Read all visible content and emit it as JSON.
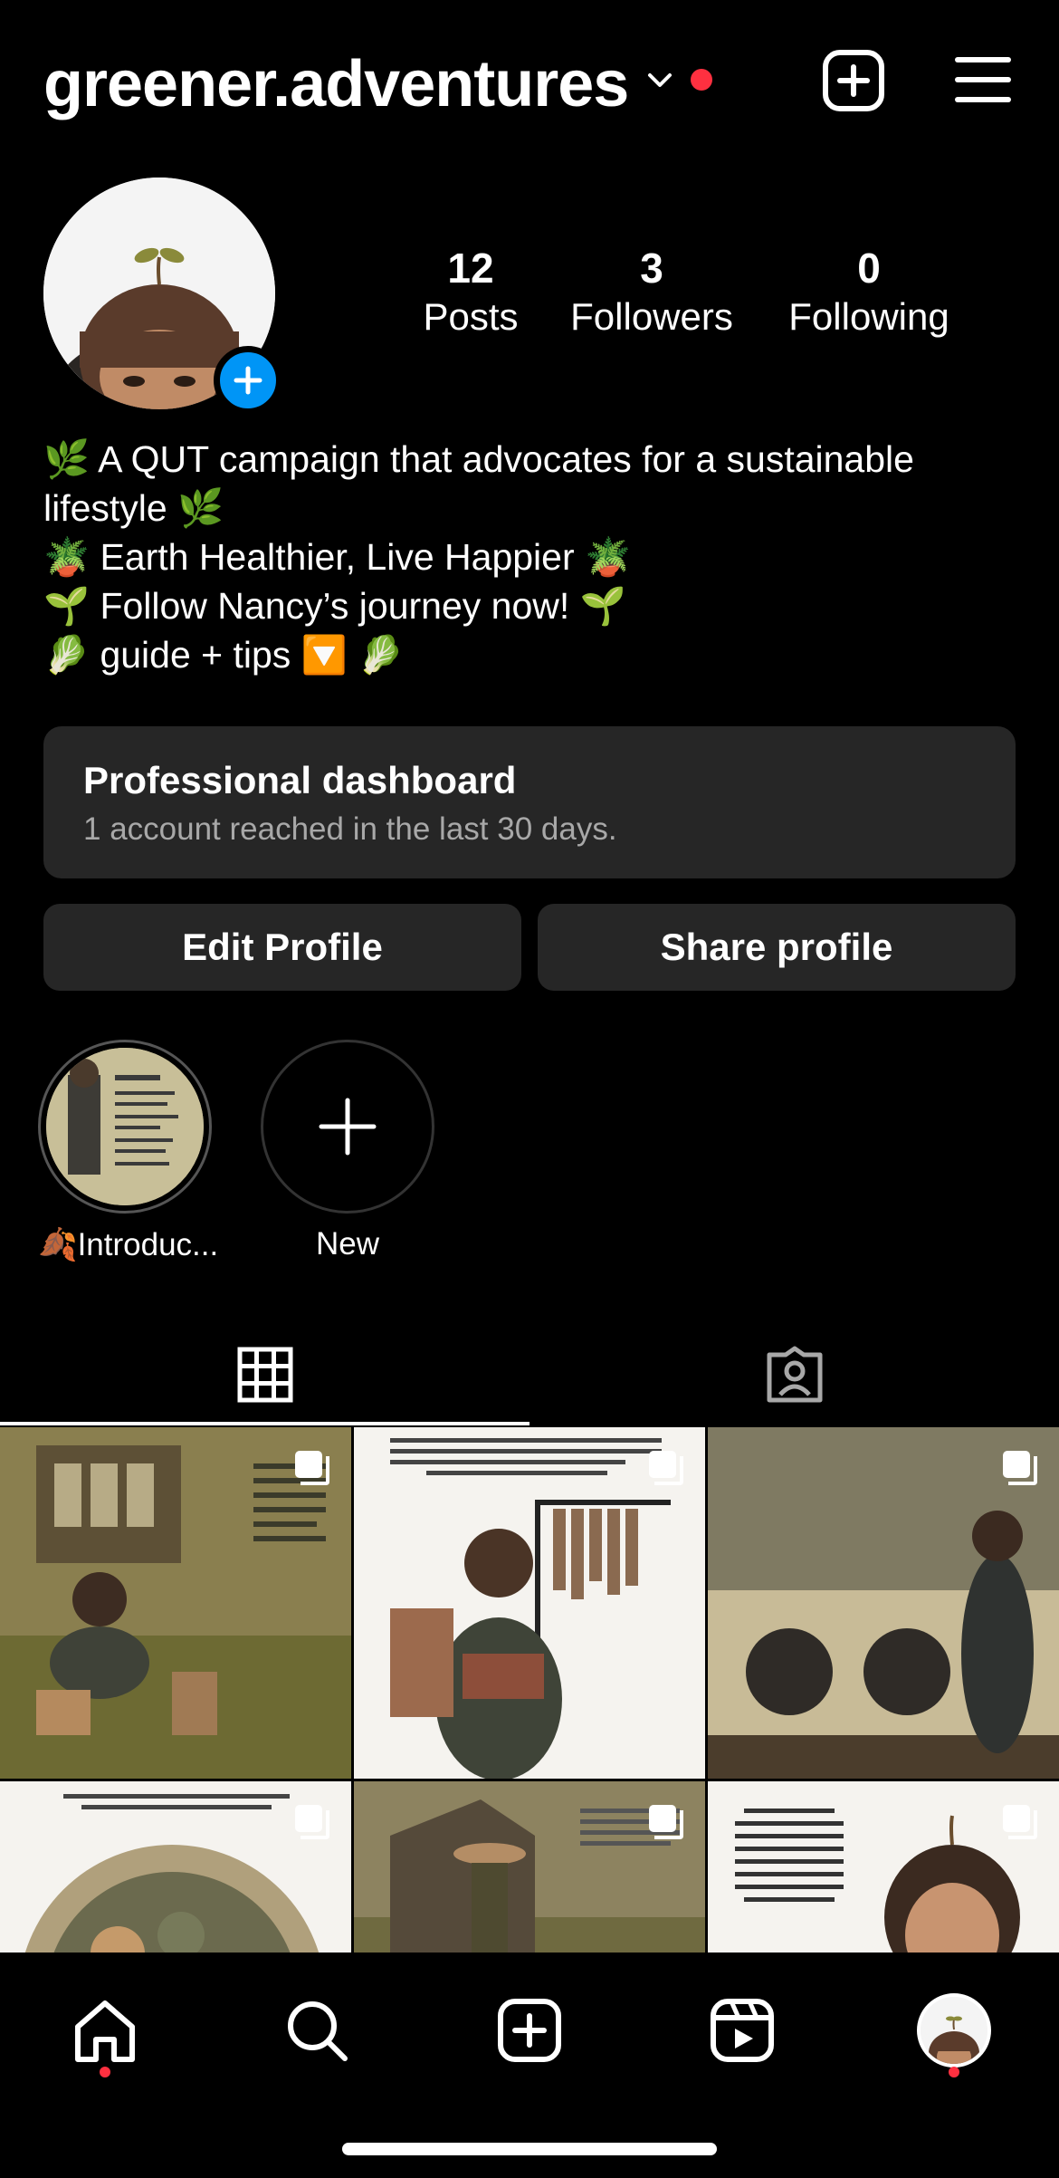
{
  "header": {
    "username": "greener.adventures",
    "notification_color": "#ff3040"
  },
  "profile": {
    "stats": [
      {
        "value": "12",
        "label": "Posts"
      },
      {
        "value": "3",
        "label": "Followers"
      },
      {
        "value": "0",
        "label": "Following"
      }
    ],
    "bio": [
      "🌿 A QUT campaign that advocates for a sustainable lifestyle 🌿",
      "🪴 Earth Healthier, Live Happier 🪴",
      "🌱 Follow Nancy’s journey now! 🌱",
      "🥬 guide + tips 🔽 🥬"
    ]
  },
  "dashboard": {
    "title": "Professional dashboard",
    "subtitle": "1 account reached in the last 30 days."
  },
  "buttons": {
    "edit": "Edit Profile",
    "share": "Share profile"
  },
  "highlights": [
    {
      "label": "🍂Introduc..."
    },
    {
      "label": "New"
    }
  ],
  "colors": {
    "accent": "#0095f6",
    "card": "#262626",
    "secondary_text": "#a8a8a8"
  },
  "icons": {
    "grid_tab": "grid-icon",
    "tagged_tab": "tagged-icon",
    "nav": [
      "home-icon",
      "search-icon",
      "create-icon",
      "reels-icon",
      "profile-avatar"
    ]
  }
}
